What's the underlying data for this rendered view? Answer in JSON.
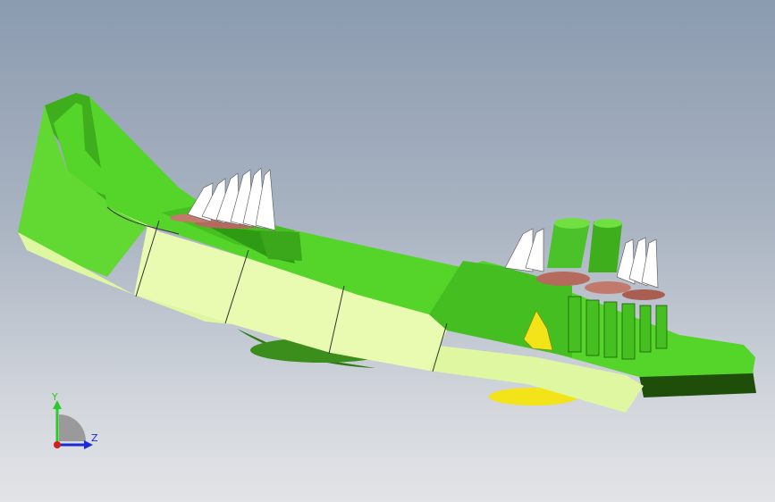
{
  "viewport": {
    "name": "3d-model-view",
    "background_top": "#8b9bb0",
    "background_bottom": "#e2e4e7"
  },
  "model": {
    "colors": {
      "body_green": "#55d42a",
      "light_face": "#e2f8a4",
      "dark_green": "#2f7a12",
      "copper": "#b46a5c",
      "white_pins": "#ffffff",
      "yellow": "#f2e418"
    }
  },
  "triad": {
    "y_label": "Y",
    "z_label": "Z",
    "y_color": "#2cc82c",
    "z_color": "#1a2ad6",
    "origin_color": "#d21e1e"
  }
}
